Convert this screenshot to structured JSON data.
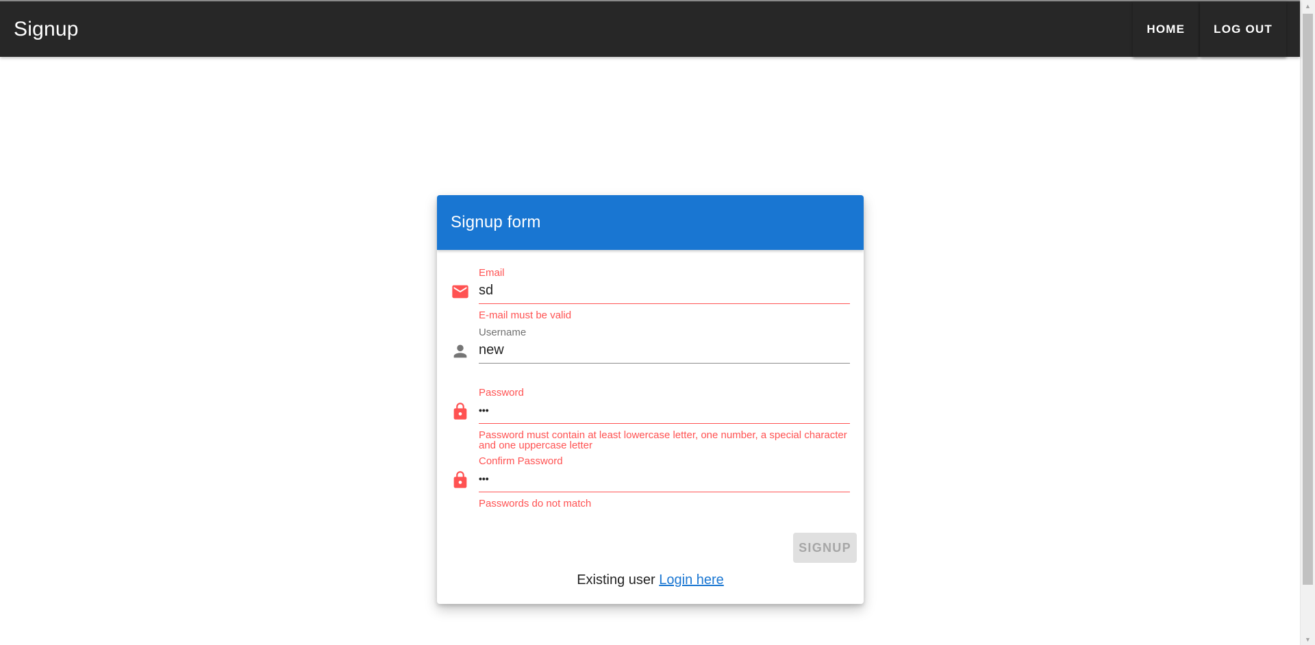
{
  "app": {
    "title": "Signup"
  },
  "nav": {
    "home_label": "HOME",
    "logout_label": "LOG OUT"
  },
  "form": {
    "title": "Signup form",
    "fields": {
      "email": {
        "label": "Email",
        "value": "sd",
        "error": "E-mail must be valid",
        "icon": "mail-icon"
      },
      "username": {
        "label": "Username",
        "value": "new",
        "icon": "person-icon"
      },
      "password": {
        "label": "Password",
        "value": "•••",
        "error": "Password must contain at least lowercase letter, one number, a special character and one uppercase letter",
        "icon": "lock-icon"
      },
      "confirm_password": {
        "label": "Confirm Password",
        "value": "•••",
        "error": "Passwords do not match",
        "icon": "lock-icon"
      }
    },
    "submit_label": "SIGNUP",
    "existing_user_text": "Existing user",
    "login_link_label": "Login here"
  },
  "colors": {
    "appbar": "#272727",
    "header": "#1976d2",
    "error": "#ff5252",
    "link": "#1976d2"
  }
}
